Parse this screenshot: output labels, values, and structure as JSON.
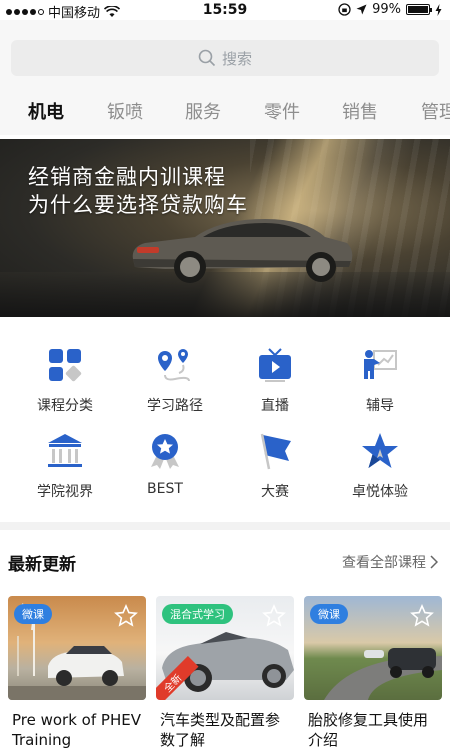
{
  "status_bar": {
    "carrier": "中国移动",
    "time": "15:59",
    "battery": "99%"
  },
  "search": {
    "placeholder": "搜索"
  },
  "tabs": [
    {
      "label": "机电",
      "active": true
    },
    {
      "label": "钣喷"
    },
    {
      "label": "服务"
    },
    {
      "label": "零件"
    },
    {
      "label": "销售"
    },
    {
      "label": "管理"
    }
  ],
  "banner": {
    "line1": "经销商金融内训课程",
    "line2": "为什么要选择贷款购车"
  },
  "categories": [
    {
      "label": "课程分类",
      "icon": "grid-icon"
    },
    {
      "label": "学习路径",
      "icon": "route-icon"
    },
    {
      "label": "直播",
      "icon": "tv-icon"
    },
    {
      "label": "辅导",
      "icon": "mentor-icon"
    },
    {
      "label": "学院视界",
      "icon": "institute-icon"
    },
    {
      "label": "BEST",
      "icon": "medal-icon"
    },
    {
      "label": "大赛",
      "icon": "flag-icon"
    },
    {
      "label": "卓悦体验",
      "icon": "star-icon"
    }
  ],
  "latest": {
    "title": "最新更新",
    "view_all": "查看全部课程",
    "cards": [
      {
        "badge": "微课",
        "title": "Pre work of PHEV Training"
      },
      {
        "badge": "混合式学习",
        "ribbon": "全新",
        "title": "汽车类型及配置参数了解"
      },
      {
        "badge": "微课",
        "title": "胎胶修复工具使用介绍"
      }
    ]
  },
  "colors": {
    "accent": "#1a5fbf",
    "icon_blue": "#2a62c9",
    "badge_blue": "#2f7fe0",
    "badge_green": "#2ec27e"
  }
}
